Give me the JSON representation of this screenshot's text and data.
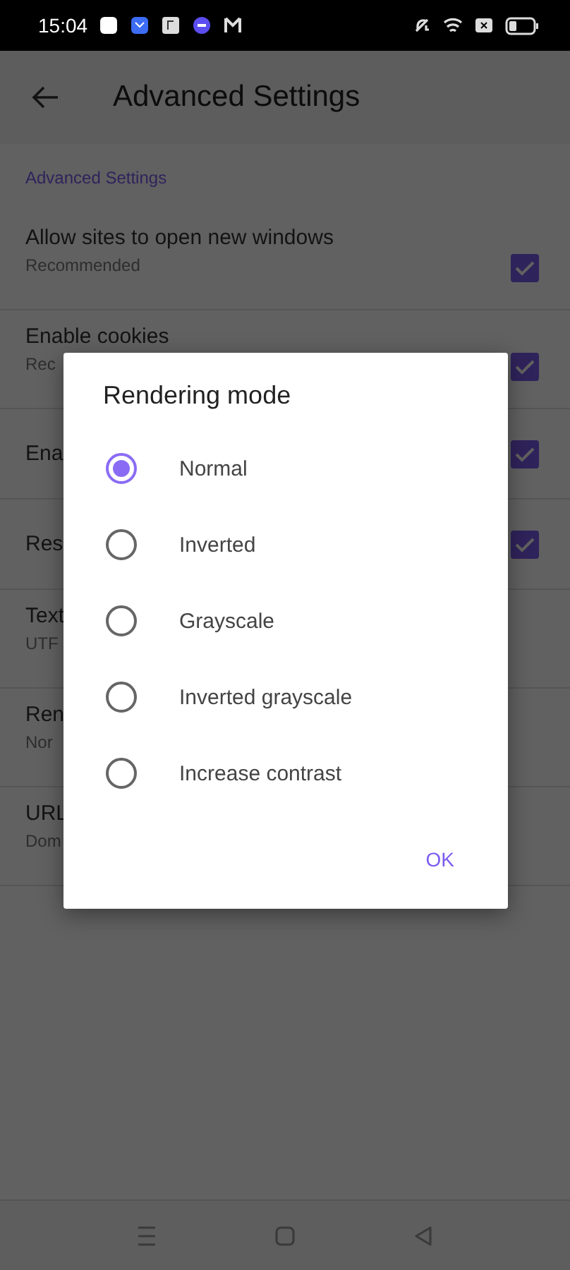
{
  "status_bar": {
    "time": "15:04"
  },
  "app_bar": {
    "title": "Advanced Settings"
  },
  "section": {
    "title": "Advanced Settings"
  },
  "settings": [
    {
      "kind": "checkbox",
      "title": "Allow sites to open new windows",
      "summary": "Recommended",
      "checked": true
    },
    {
      "kind": "checkbox",
      "title": "Enable cookies",
      "summary": "Rec",
      "checked": true
    },
    {
      "kind": "checkbox",
      "title": "Ena",
      "checked": true
    },
    {
      "kind": "checkbox",
      "title": "Res",
      "checked": true
    },
    {
      "kind": "text",
      "title": "Text",
      "summary": "UTF"
    },
    {
      "kind": "text",
      "title": "Ren",
      "summary": "Nor"
    },
    {
      "kind": "text",
      "title": "URL",
      "summary": "Dom"
    }
  ],
  "dialog": {
    "title": "Rendering mode",
    "options": [
      {
        "label": "Normal",
        "selected": true
      },
      {
        "label": "Inverted",
        "selected": false
      },
      {
        "label": "Grayscale",
        "selected": false
      },
      {
        "label": "Inverted grayscale",
        "selected": false
      },
      {
        "label": "Increase contrast",
        "selected": false
      }
    ],
    "button": "OK"
  }
}
